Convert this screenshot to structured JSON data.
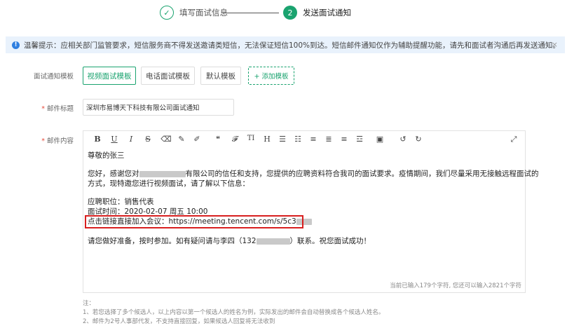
{
  "stepper": {
    "step1": {
      "num": "✓",
      "label": "填写面试信息"
    },
    "step2": {
      "num": "2",
      "label": "发送面试通知"
    }
  },
  "notice": {
    "icon": "info-icon",
    "text": "温馨提示：应相关部门监管要求，短信服务商不得发送邀请类短信，无法保证短信100%到达。短信邮件通知仅作为辅助提醒功能，请先和面试者沟通后再发送通知。",
    "close": "×"
  },
  "form": {
    "template_label": "面试通知模板",
    "templates": [
      "视频面试模板",
      "电话面试模板",
      "默认模板"
    ],
    "add_template": "+ 添加模板",
    "subject_label": "邮件标题",
    "subject_value": "深圳市易博天下科技有限公司面试通知",
    "content_label": "邮件内容"
  },
  "toolbar": [
    "B",
    "U",
    "I",
    "S",
    "⌫",
    "✎",
    "✐",
    "❝",
    "𝓕",
    "TI",
    "H",
    "☰",
    "☷",
    "≡",
    "≣",
    "≡",
    "☲",
    "▣",
    "↺",
    "↻",
    "⤢"
  ],
  "editor": {
    "greeting": "尊敬的张三",
    "para1_a": "您好，感谢您对",
    "para1_b": "有限公司的信任和支持，您提供的应聘资料符合我司的面试要求。疫情期间，我们尽量采用无接触远程面试的",
    "para1_c": "方式，现特邀您进行视频面试，请了解以下信息：",
    "position": "应聘职位：销售代表",
    "time": "面试时间：2020-02-07 周五 10:00",
    "link": "点击链接直接加入会议：https://meeting.tencent.com/s/5c3",
    "closing_a": "请您做好准备，按时参加。如有疑问请与李四（132",
    "closing_b": "）联系。祝您面试成功！",
    "counter": "当前已输入179个字符, 您还可以输入2821个字符"
  },
  "notes": {
    "title": "注：",
    "line1": "1、若您选择了多个候选人，以上内容以第一个候选人的姓名为例，实际发出的邮件会自动替换成各个候选人姓名。",
    "line2": "2、邮件为2号人事部代发，不支持直接回复，如果候选人回复将无法收到"
  }
}
